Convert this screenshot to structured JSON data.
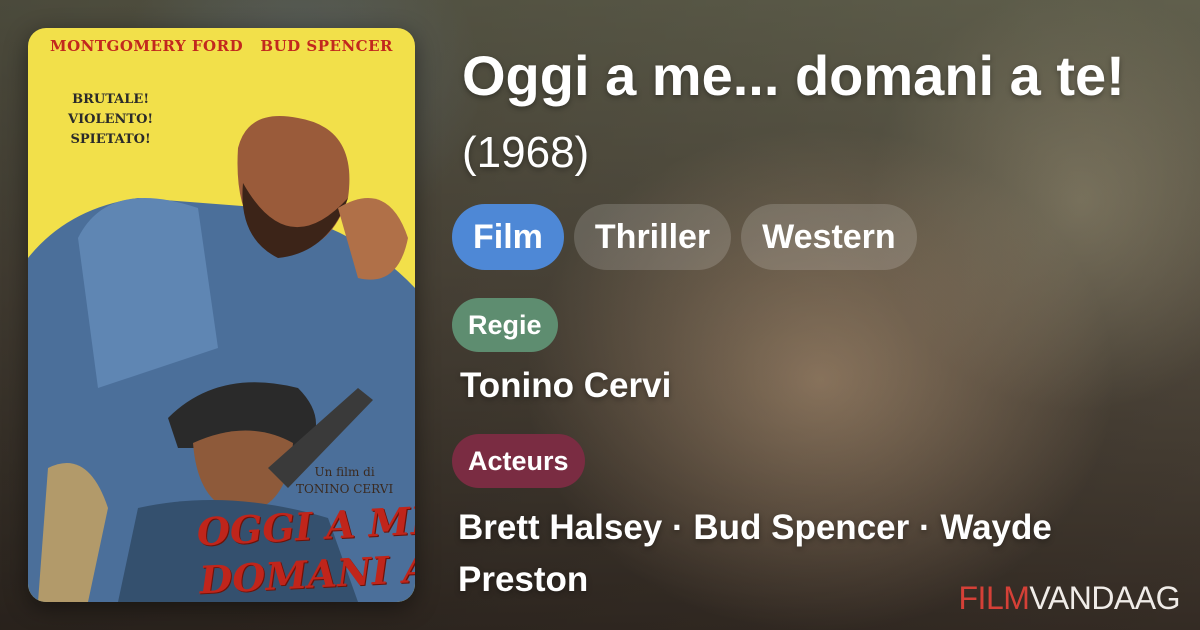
{
  "poster": {
    "top_left_name": "MONTGOMERY FORD",
    "top_right_name": "BUD SPENCER",
    "tagline": [
      "BRUTALE!",
      "VIOLENTO!",
      "SPIETATO!"
    ],
    "credit_line1": "Un film di",
    "credit_line2": "TONINO CERVI",
    "title_line1": "OGGI A ME...",
    "title_line2": "DOMANI A TE!",
    "colors": {
      "background": "#f2e04a",
      "title": "#c0251b"
    }
  },
  "movie": {
    "title": "Oggi a me... domani a te!",
    "year": "(1968)"
  },
  "genres": [
    {
      "label": "Film",
      "color": "#4e88d6"
    },
    {
      "label": "Thriller"
    },
    {
      "label": "Western"
    }
  ],
  "director": {
    "label": "Regie",
    "value": "Tonino Cervi",
    "color": "#5e8d70"
  },
  "cast": {
    "label": "Acteurs",
    "value": "Brett Halsey · Bud Spencer · Wayde Preston",
    "color": "#7a2c42"
  },
  "brand": {
    "part1": "FILM",
    "part2": "VANDAAG",
    "color1": "#d54037",
    "color2": "#f0ece8"
  }
}
